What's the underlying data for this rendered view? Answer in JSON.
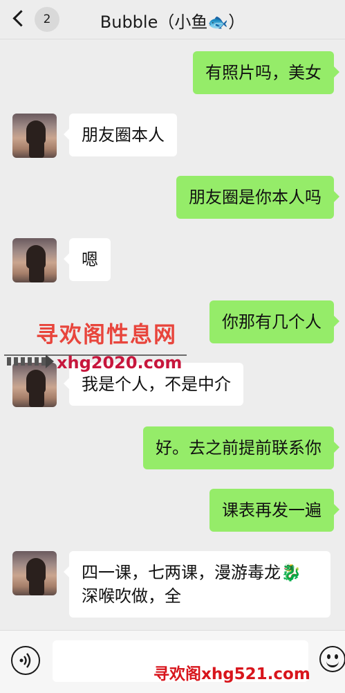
{
  "header": {
    "back_badge": "2",
    "title": "Bubble（小鱼🐟）"
  },
  "messages": [
    {
      "side": "out",
      "text": "有照片吗，美女"
    },
    {
      "side": "in",
      "text": "朋友圈本人"
    },
    {
      "side": "out",
      "text": "朋友圈是你本人吗"
    },
    {
      "side": "in",
      "text": "嗯"
    },
    {
      "side": "out",
      "text": "你那有几个人"
    },
    {
      "side": "in",
      "text": "我是个人，不是中介"
    },
    {
      "side": "out",
      "text": "好。去之前提前联系你"
    },
    {
      "side": "out",
      "text": "课表再发一遍"
    },
    {
      "side": "in",
      "lines": [
        "四一课，七两课，漫游毒龙🐉",
        "深喉吹做，全"
      ]
    }
  ],
  "overlays": {
    "watermark_cn": "寻欢阁性息网",
    "watermark_url": "xhg2020.com",
    "footer_watermark": "寻欢阁xhg521.com"
  },
  "input_bar": {
    "placeholder": ""
  },
  "icons": {
    "back": "chevron-left-icon",
    "voice": "voice-icon",
    "emoji": "emoji-icon"
  }
}
